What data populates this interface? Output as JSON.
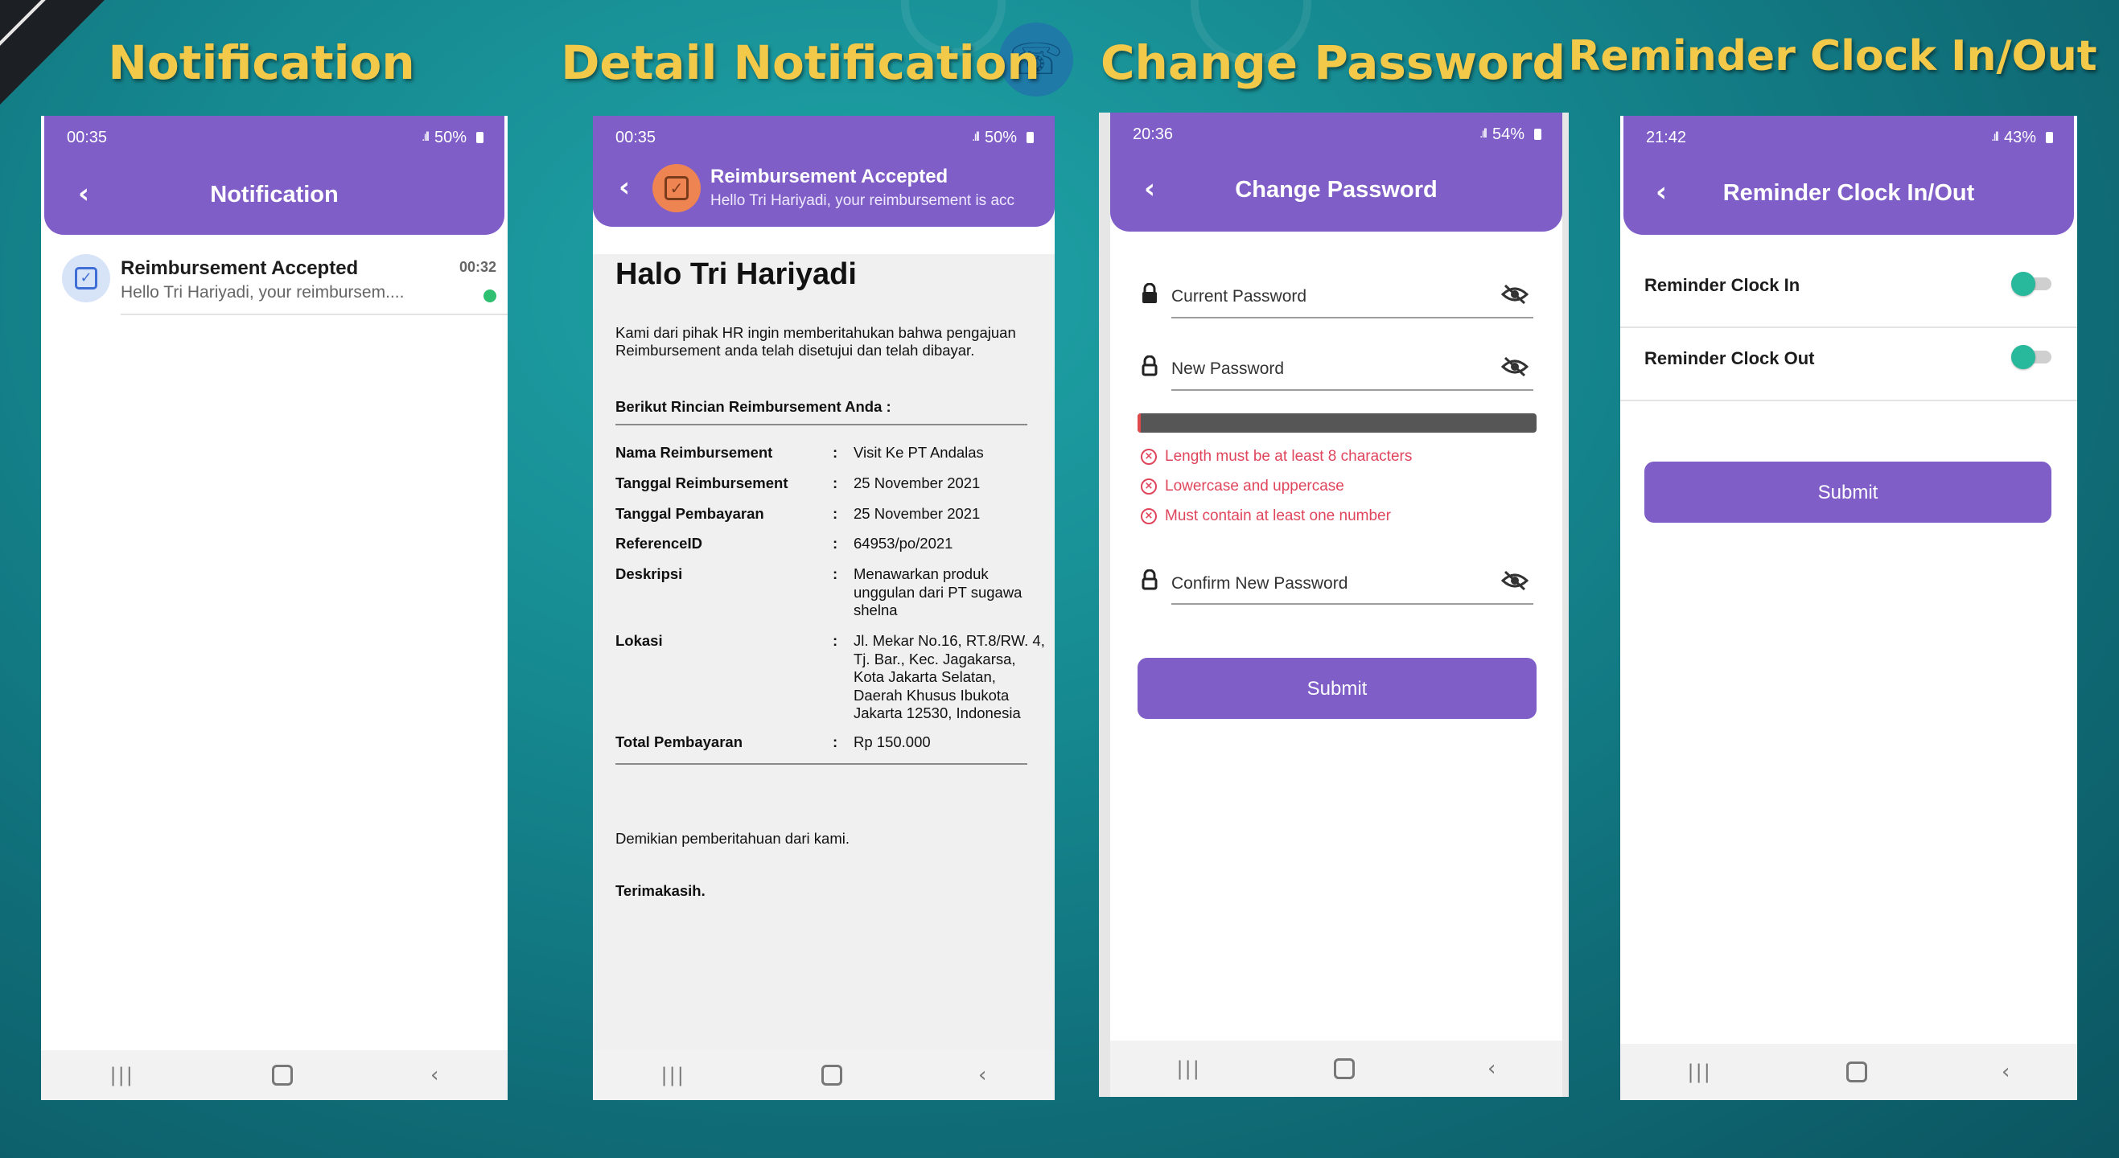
{
  "titles": {
    "notification": "Notification",
    "detail": "Detail Notification",
    "password": "Change Password",
    "reminder": "Reminder Clock In/Out"
  },
  "phone1": {
    "status": {
      "time": "00:35",
      "battery": "50%"
    },
    "appbar_title": "Notification",
    "notification": {
      "title": "Reimbursement Accepted",
      "message": "Hello Tri Hariyadi, your reimbursem....",
      "time": "00:32"
    }
  },
  "phone2": {
    "status": {
      "time": "00:35",
      "battery": "50%"
    },
    "header": {
      "title": "Reimbursement Accepted",
      "message": "Hello Tri Hariyadi, your reimbursement is acc"
    },
    "heading": "Halo Tri Hariyadi",
    "intro": "Kami dari pihak HR ingin memberitahukan bahwa pengajuan Reimbursement anda telah disetujui dan telah dibayar.",
    "subheading": "Berikut Rincian Reimbursement Anda :",
    "rows": [
      {
        "label": "Nama Reimbursement",
        "colon": ":",
        "value": "Visit Ke PT Andalas"
      },
      {
        "label": "Tanggal Reimbursement",
        "colon": ":",
        "value": "25 November 2021"
      },
      {
        "label": "Tanggal Pembayaran",
        "colon": ":",
        "value": "25 November 2021"
      },
      {
        "label": "ReferenceID",
        "colon": ":",
        "value": "64953/po/2021"
      },
      {
        "label": "Deskripsi",
        "colon": ":",
        "value": "Menawarkan produk unggulan dari PT sugawa shelna"
      },
      {
        "label": "Lokasi",
        "colon": ":",
        "value": "Jl. Mekar No.16, RT.8/RW. 4, Tj. Bar., Kec. Jagakarsa, Kota Jakarta Selatan, Daerah Khusus Ibukota Jakarta 12530, Indonesia"
      },
      {
        "label": "Total Pembayaran",
        "colon": ":",
        "value": "Rp 150.000"
      }
    ],
    "closing": "Demikian pemberitahuan dari kami.",
    "thanks": "Terimakasih."
  },
  "phone3": {
    "status": {
      "time": "20:36",
      "battery": "54%"
    },
    "appbar_title": "Change Password",
    "fields": {
      "current": "Current Password",
      "new": "New Password",
      "confirm": "Confirm New Password"
    },
    "strength_fraction": 0.01,
    "errors": [
      "Length must be at least 8 characters",
      "Lowercase and uppercase",
      "Must contain at least one number"
    ],
    "submit_label": "Submit"
  },
  "phone4": {
    "status": {
      "time": "21:42",
      "battery": "43%"
    },
    "appbar_title": "Reminder Clock In/Out",
    "toggles": [
      {
        "label": "Reminder Clock In"
      },
      {
        "label": "Reminder Clock Out"
      }
    ],
    "submit_label": "Submit"
  },
  "colors": {
    "brand_purple": "#7f5ec8",
    "title_gold": "#f3c94a",
    "error_red": "#e0455c",
    "toggle_teal": "#28b89b"
  }
}
